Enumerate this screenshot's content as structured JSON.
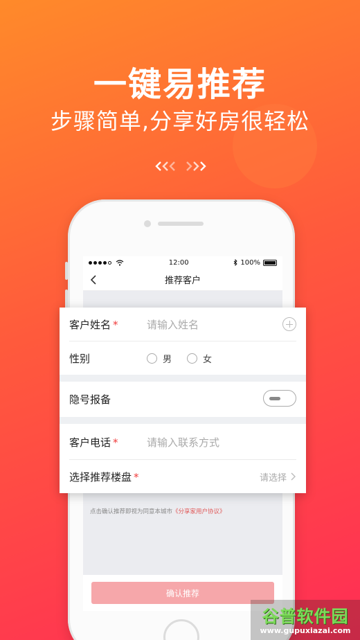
{
  "promo": {
    "headline": "一键易推荐",
    "subline": "步骤简单,分享好房很轻松"
  },
  "status_bar": {
    "time": "12:00",
    "battery": "100%"
  },
  "nav": {
    "title": "推荐客户"
  },
  "form": {
    "name_label": "客户姓名",
    "name_placeholder": "请输入姓名",
    "gender_label": "性别",
    "gender_options": [
      "男",
      "女"
    ],
    "hidden_label": "隐号报备",
    "phone_label": "客户电话",
    "phone_placeholder": "请输入联系方式",
    "property_label": "选择推荐楼盘",
    "property_hint": "请选择",
    "required_mark": "*"
  },
  "agreement": {
    "prefix": "点击确认推荐即视为同意本城市",
    "link": "《分享家用户协议》"
  },
  "confirm_label": "确认推荐",
  "watermark": {
    "title": "谷普软件园",
    "url": "www.gupuxiazai.com"
  },
  "colors": {
    "gradient_start": "#ff8a2a",
    "gradient_end": "#ff2d55",
    "required": "#f03c3c",
    "confirm_button": "#f6a7aa"
  },
  "icons": {
    "back": "chevron-left-icon",
    "add": "plus-circle-icon",
    "more": "chevron-right-icon"
  }
}
